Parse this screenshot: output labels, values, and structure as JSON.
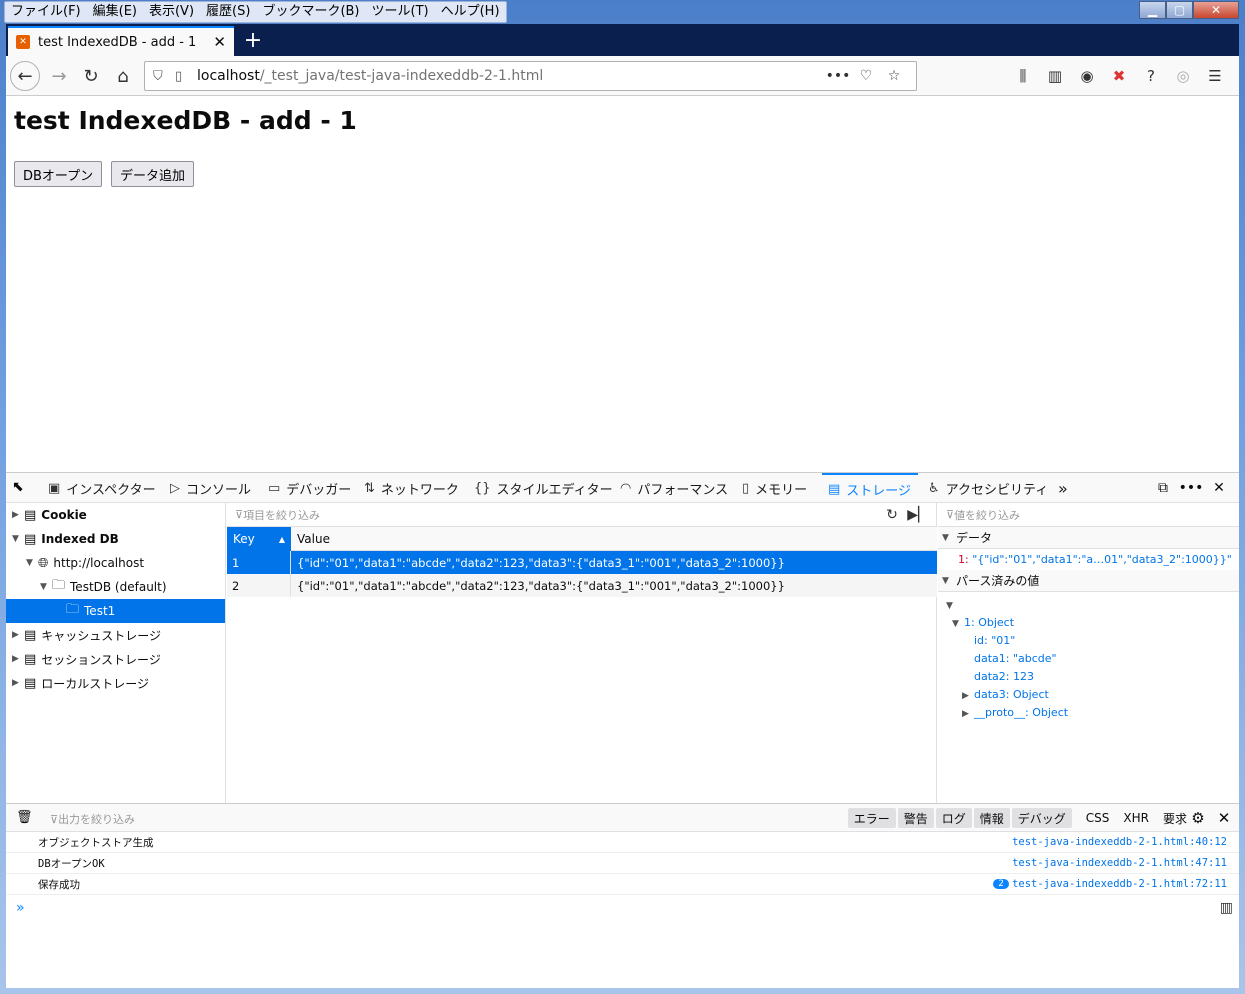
{
  "menu": [
    "ファイル(F)",
    "編集(E)",
    "表示(V)",
    "履歴(S)",
    "ブックマーク(B)",
    "ツール(T)",
    "ヘルプ(H)"
  ],
  "tab": {
    "title": "test IndexedDB - add - 1"
  },
  "url": {
    "host": "localhost",
    "path": "/_test_java/test-java-indexeddb-2-1.html"
  },
  "page": {
    "heading": "test IndexedDB - add - 1",
    "btn_open": "DBオープン",
    "btn_add": "データ追加"
  },
  "devtools": {
    "tabs": [
      "インスペクター",
      "コンソール",
      "デバッガー",
      "ネットワーク",
      "スタイルエディター",
      "パフォーマンス",
      "メモリー",
      "ストレージ",
      "アクセシビリティ"
    ],
    "tree": {
      "cookie": "Cookie",
      "indexeddb": "Indexed DB",
      "origin": "http://localhost",
      "db": "TestDB (default)",
      "store": "Test1",
      "cache": "キャッシュストレージ",
      "session": "セッションストレージ",
      "local": "ローカルストレージ"
    },
    "table": {
      "filter_placeholder": "項目を絞り込み",
      "col_key": "Key",
      "col_value": "Value",
      "rows": [
        {
          "key": "1",
          "value": "{\"id\":\"01\",\"data1\":\"abcde\",\"data2\":123,\"data3\":{\"data3_1\":\"001\",\"data3_2\":1000}}"
        },
        {
          "key": "2",
          "value": "{\"id\":\"01\",\"data1\":\"abcde\",\"data2\":123,\"data3\":{\"data3_1\":\"001\",\"data3_2\":1000}}"
        }
      ]
    },
    "sidebar": {
      "filter_placeholder": "値を絞り込み",
      "data_header": "データ",
      "data_key": "1:",
      "data_value": "\"{\"id\":\"01\",\"data1\":\"a…01\",\"data3_2\":1000}}\"",
      "parsed_header": "パース済みの値",
      "obj_label": "1: Object",
      "id": "id: \"01\"",
      "data1": "data1: \"abcde\"",
      "data2": "data2: 123",
      "data3": "data3: Object",
      "proto": "__proto__: Object"
    },
    "console": {
      "filter_placeholder": "出力を絞り込み",
      "filters": [
        "エラー",
        "警告",
        "ログ",
        "情報",
        "デバッグ",
        "CSS",
        "XHR",
        "要求"
      ],
      "messages": [
        {
          "text": "オブジェクトストア生成",
          "loc": "test-java-indexeddb-2-1.html:40:12"
        },
        {
          "text": "DBオープンOK",
          "loc": "test-java-indexeddb-2-1.html:47:11"
        },
        {
          "text": "保存成功",
          "loc": "test-java-indexeddb-2-1.html:72:11",
          "badge": "2"
        }
      ]
    }
  }
}
